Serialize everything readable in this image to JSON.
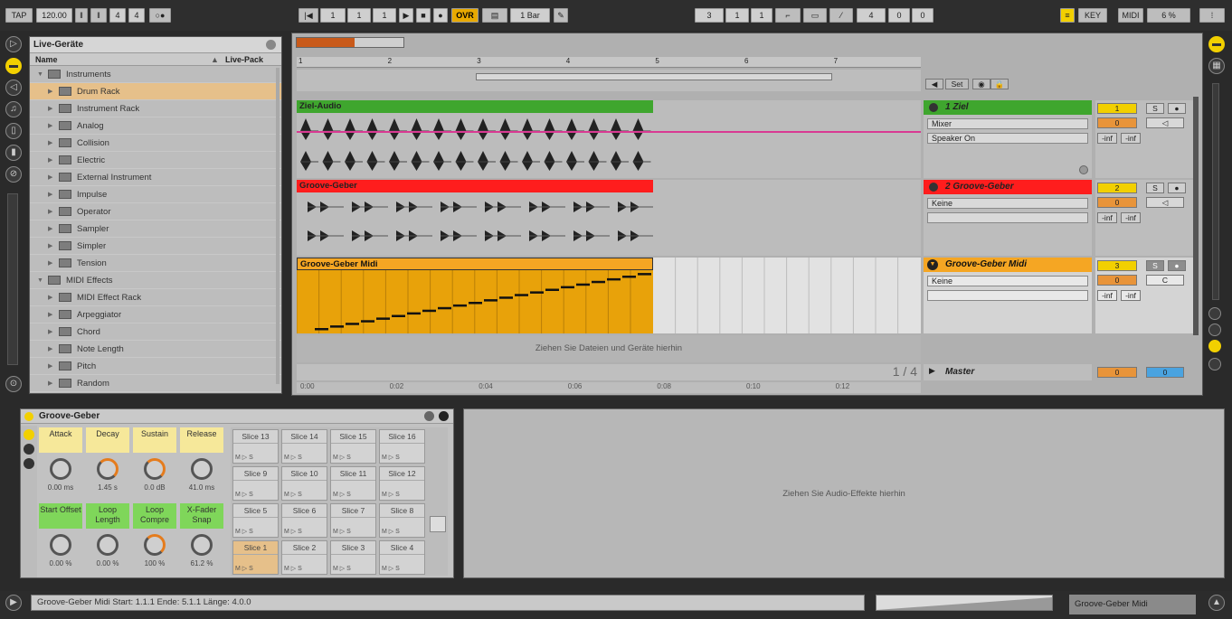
{
  "transport": {
    "tap": "TAP",
    "tempo": "120.00",
    "sig_num": "4",
    "sig_den": "4",
    "metro": "○●",
    "pos_bar": "1",
    "pos_beat": "1",
    "pos_sixteenth": "1",
    "ovr": "OVR",
    "quant": "1 Bar",
    "loop_start": "3",
    "loop_beat": "1",
    "loop_sixteenth": "1",
    "loop_len_bar": "4",
    "loop_len_beat": "0",
    "loop_len_sixteenth": "0",
    "key": "KEY",
    "midi": "MIDI",
    "cpu": "6 %"
  },
  "browser": {
    "title": "Live-Geräte",
    "col_name": "Name",
    "col_pack": "Live-Pack",
    "items": [
      {
        "label": "Instruments",
        "level": 0,
        "open": true
      },
      {
        "label": "Drum Rack",
        "level": 1,
        "selected": true
      },
      {
        "label": "Instrument Rack",
        "level": 1
      },
      {
        "label": "Analog",
        "level": 1
      },
      {
        "label": "Collision",
        "level": 1
      },
      {
        "label": "Electric",
        "level": 1
      },
      {
        "label": "External Instrument",
        "level": 1
      },
      {
        "label": "Impulse",
        "level": 1
      },
      {
        "label": "Operator",
        "level": 1
      },
      {
        "label": "Sampler",
        "level": 1
      },
      {
        "label": "Simpler",
        "level": 1
      },
      {
        "label": "Tension",
        "level": 1
      },
      {
        "label": "MIDI Effects",
        "level": 0,
        "open": true
      },
      {
        "label": "MIDI Effect Rack",
        "level": 1
      },
      {
        "label": "Arpeggiator",
        "level": 1
      },
      {
        "label": "Chord",
        "level": 1
      },
      {
        "label": "Note Length",
        "level": 1
      },
      {
        "label": "Pitch",
        "level": 1
      },
      {
        "label": "Random",
        "level": 1
      }
    ]
  },
  "arrangement": {
    "ruler_bars": [
      "1",
      "2",
      "3",
      "4",
      "5",
      "6",
      "7"
    ],
    "time_ticks": [
      "0:00",
      "0:02",
      "0:04",
      "0:06",
      "0:08",
      "0:10",
      "0:12"
    ],
    "set_label": "Set",
    "drop_hint": "Ziehen Sie Dateien und Geräte hierhin",
    "page": "1 / 4",
    "tracks": [
      {
        "clip": "Ziel-Audio",
        "name": "1 Ziel",
        "num": "1",
        "vol": "0",
        "input": "Mixer",
        "monitor": "Speaker On",
        "inf1": "-inf",
        "inf2": "-inf",
        "color": "#3fa62e"
      },
      {
        "clip": "Groove-Geber",
        "name": "2 Groove-Geber",
        "num": "2",
        "vol": "0",
        "input": "Keine",
        "inf1": "-inf",
        "inf2": "-inf",
        "color": "#ff1d1d"
      },
      {
        "clip": "Groove-Geber Midi",
        "name": "Groove-Geber Midi",
        "num": "3",
        "vol": "0",
        "input": "Keine",
        "pan": "C",
        "inf1": "-inf",
        "inf2": "-inf",
        "color": "#f5a623"
      }
    ],
    "master": "Master",
    "master_vol": "0",
    "master_pan": "0",
    "solo": "S"
  },
  "device": {
    "title": "Groove-Geber",
    "macros_top": [
      {
        "label": "Attack",
        "value": "0.00 ms"
      },
      {
        "label": "Decay",
        "value": "1.45 s"
      },
      {
        "label": "Sustain",
        "value": "0.0 dB"
      },
      {
        "label": "Release",
        "value": "41.0 ms"
      }
    ],
    "macros_bottom": [
      {
        "label": "Start Offset",
        "value": "0.00 %"
      },
      {
        "label": "Loop Length",
        "value": "0.00 %"
      },
      {
        "label": "Loop Compre",
        "value": "100 %"
      },
      {
        "label": "X-Fader Snap",
        "value": "61.2 %"
      }
    ],
    "slices": [
      [
        "Slice 13",
        "Slice 14",
        "Slice 15",
        "Slice 16"
      ],
      [
        "Slice 9",
        "Slice 10",
        "Slice 11",
        "Slice 12"
      ],
      [
        "Slice 5",
        "Slice 6",
        "Slice 7",
        "Slice 8"
      ],
      [
        "Slice 1",
        "Slice 2",
        "Slice 3",
        "Slice 4"
      ]
    ],
    "slice_buttons": "M ▷ S"
  },
  "fx_drop_hint": "Ziehen Sie Audio-Effekte hierhin",
  "status": {
    "info": "Groove-Geber Midi  Start: 1.1.1  Ende: 5.1.1  Länge: 4.0.0",
    "track": "Groove-Geber Midi"
  }
}
